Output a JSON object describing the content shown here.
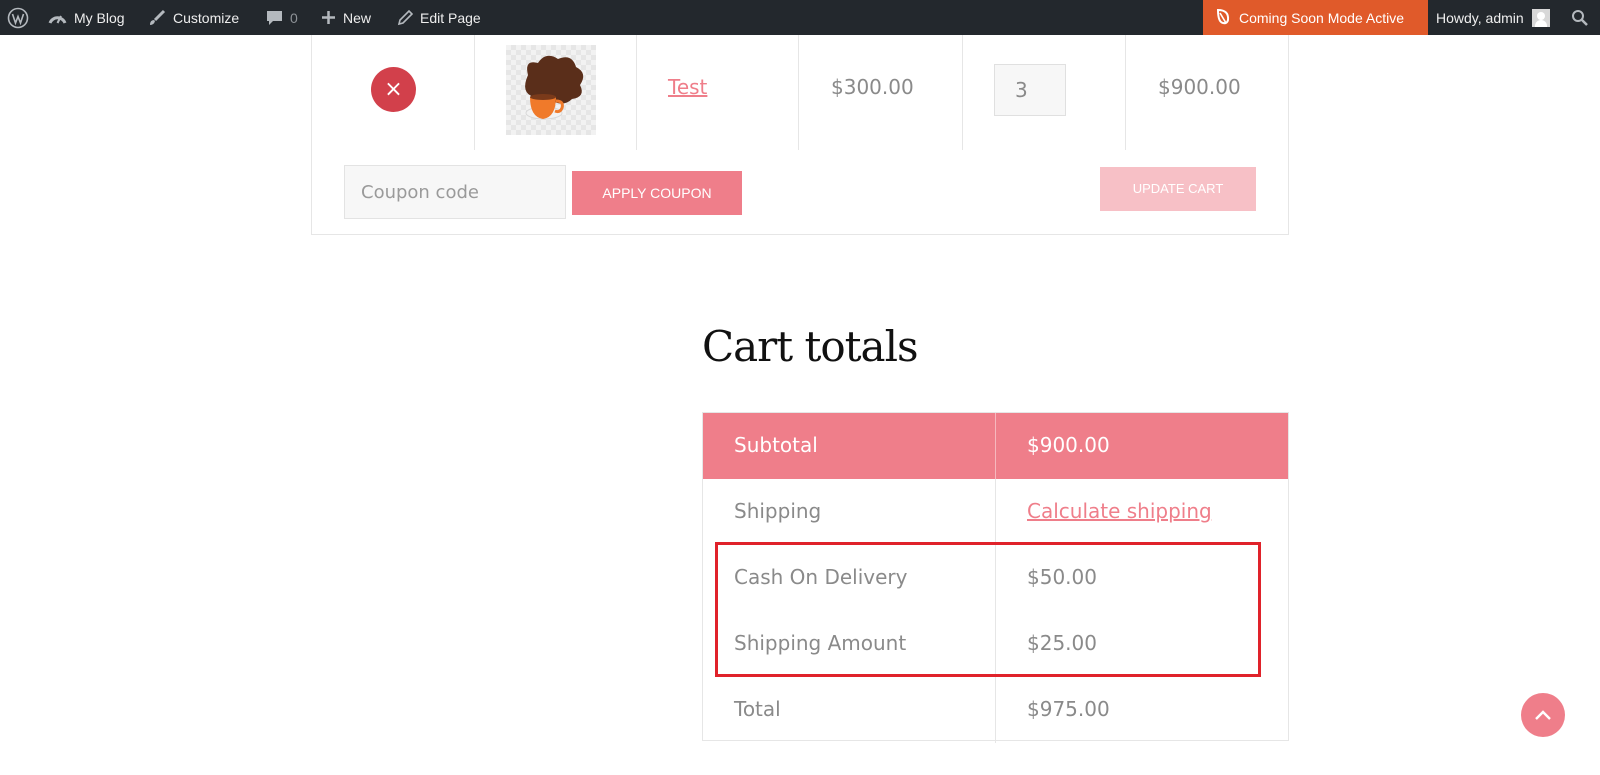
{
  "admin_bar": {
    "site_name": "My Blog",
    "customize": "Customize",
    "comments_count": "0",
    "new_label": "New",
    "edit_page": "Edit Page",
    "coming_soon": "Coming Soon Mode Active",
    "howdy": "Howdy, admin",
    "icons": [
      "wordpress-logo-icon",
      "dashboard-icon",
      "brush-icon",
      "comment-icon",
      "plus-icon",
      "pencil-icon",
      "leaf-icon",
      "avatar",
      "search-icon"
    ]
  },
  "cart": {
    "item": {
      "remove_symbol": "×",
      "product_name": "Test",
      "price": "$300.00",
      "quantity": "3",
      "subtotal": "$900.00"
    },
    "coupon_placeholder": "Coupon code",
    "apply_coupon_label": "APPLY COUPON",
    "update_cart_label": "UPDATE CART"
  },
  "totals": {
    "heading": "Cart totals",
    "rows": [
      {
        "label": "Subtotal",
        "value": "$900.00"
      },
      {
        "label": "Shipping",
        "value": "Calculate shipping"
      },
      {
        "label": "Cash On Delivery",
        "value": "$50.00"
      },
      {
        "label": "Shipping Amount",
        "value": "$25.00"
      },
      {
        "label": "Total",
        "value": "$975.00"
      }
    ]
  },
  "colors": {
    "accent": "#ef7e8a",
    "remove": "#d2404b",
    "admin_bar": "#23282d",
    "coming_soon": "#e05a2a",
    "highlight": "#e0222a"
  }
}
